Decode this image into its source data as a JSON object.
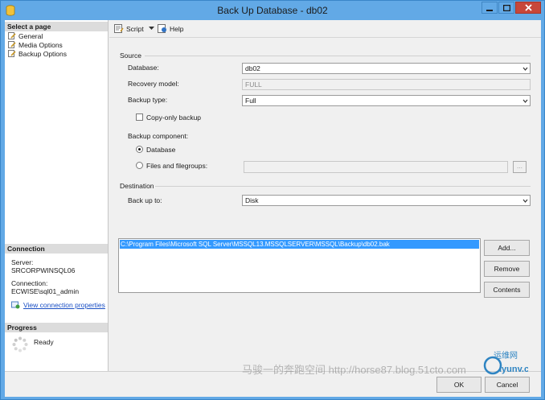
{
  "window": {
    "title": "Back Up Database - db02"
  },
  "left": {
    "select_page_header": "Select a page",
    "pages": [
      "General",
      "Media Options",
      "Backup Options"
    ],
    "connection_header": "Connection",
    "server_label": "Server:",
    "server_value": "SRCORPWINSQL06",
    "connection_label": "Connection:",
    "connection_value": "ECWISE\\sql01_admin",
    "view_connection_link": "View connection properties",
    "progress_header": "Progress",
    "progress_status": "Ready"
  },
  "toolbar": {
    "script_label": "Script",
    "help_label": "Help"
  },
  "source": {
    "group_label": "Source",
    "database_label": "Database:",
    "database_value": "db02",
    "recovery_model_label": "Recovery model:",
    "recovery_model_value": "FULL",
    "backup_type_label": "Backup type:",
    "backup_type_value": "Full",
    "copy_only_label": "Copy-only backup",
    "copy_only_checked": false,
    "component_label": "Backup component:",
    "component_database_label": "Database",
    "component_files_label": "Files and filegroups:",
    "selected_component": "Database",
    "browse_label": "..."
  },
  "destination": {
    "group_label": "Destination",
    "back_up_to_label": "Back up to:",
    "back_up_to_value": "Disk",
    "paths": [
      "C:\\Program Files\\Microsoft SQL Server\\MSSQL13.MSSQLSERVER\\MSSQL\\Backup\\db02.bak"
    ],
    "add_label": "Add...",
    "remove_label": "Remove",
    "contents_label": "Contents"
  },
  "footer": {
    "ok_label": "OK",
    "cancel_label": "Cancel",
    "watermark": "马骏一的奔跑空间 http://horse87.blog.51cto.com",
    "logo_text": "运维网",
    "logo_subtext": "iyunv.com"
  }
}
